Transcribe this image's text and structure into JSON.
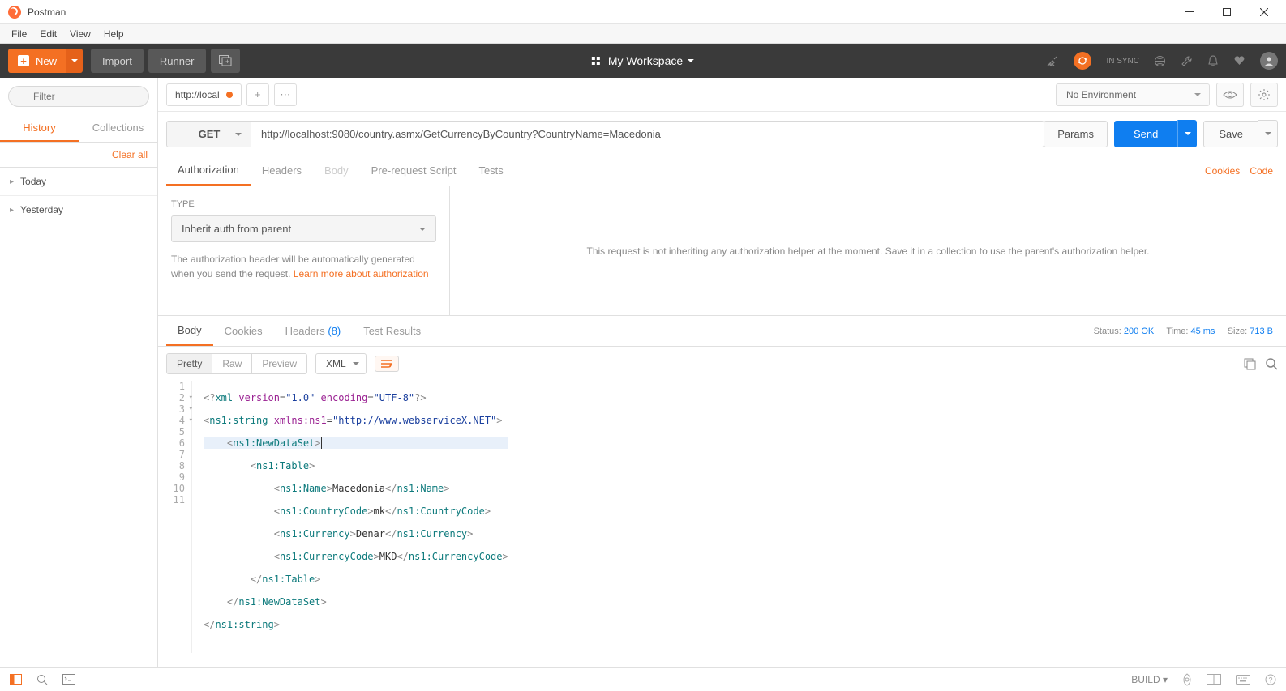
{
  "window": {
    "title": "Postman"
  },
  "menu": {
    "file": "File",
    "edit": "Edit",
    "view": "View",
    "help": "Help"
  },
  "toolbar": {
    "new": "New",
    "import": "Import",
    "runner": "Runner",
    "workspace": "My Workspace",
    "sync": "IN SYNC"
  },
  "sidebar": {
    "filter_placeholder": "Filter",
    "tabs": {
      "history": "History",
      "collections": "Collections"
    },
    "clear_all": "Clear all",
    "history_groups": [
      "Today",
      "Yesterday"
    ]
  },
  "environment": {
    "selected": "No Environment"
  },
  "request": {
    "tab_label": "http://local",
    "method": "GET",
    "url": "http://localhost:9080/country.asmx/GetCurrencyByCountry?CountryName=Macedonia",
    "buttons": {
      "params": "Params",
      "send": "Send",
      "save": "Save"
    },
    "subtabs": {
      "authorization": "Authorization",
      "headers": "Headers",
      "body": "Body",
      "prerequest": "Pre-request Script",
      "tests": "Tests"
    },
    "links": {
      "cookies": "Cookies",
      "code": "Code"
    },
    "auth": {
      "type_label": "TYPE",
      "type_value": "Inherit auth from parent",
      "description": "The authorization header will be automatically generated when you send the request. ",
      "learn_more": "Learn more about authorization",
      "message": "This request is not inheriting any authorization helper at the moment. Save it in a collection to use the parent's authorization helper."
    }
  },
  "response": {
    "tabs": {
      "body": "Body",
      "cookies": "Cookies",
      "headers": "Headers",
      "headers_count": "(8)",
      "tests": "Test Results"
    },
    "status": {
      "label": "Status:",
      "value": "200 OK"
    },
    "time": {
      "label": "Time:",
      "value": "45 ms"
    },
    "size": {
      "label": "Size:",
      "value": "713 B"
    },
    "view": {
      "pretty": "Pretty",
      "raw": "Raw",
      "preview": "Preview",
      "format": "XML"
    },
    "code": {
      "lines": [
        "<?xml version=\"1.0\" encoding=\"UTF-8\"?>",
        "<ns1:string xmlns:ns1=\"http://www.webserviceX.NET\">",
        "    <ns1:NewDataSet>",
        "        <ns1:Table>",
        "            <ns1:Name>Macedonia</ns1:Name>",
        "            <ns1:CountryCode>mk</ns1:CountryCode>",
        "            <ns1:Currency>Denar</ns1:Currency>",
        "            <ns1:CurrencyCode>MKD</ns1:CurrencyCode>",
        "        </ns1:Table>",
        "    </ns1:NewDataSet>",
        "</ns1:string>"
      ]
    }
  },
  "statusbar": {
    "build": "BUILD"
  }
}
